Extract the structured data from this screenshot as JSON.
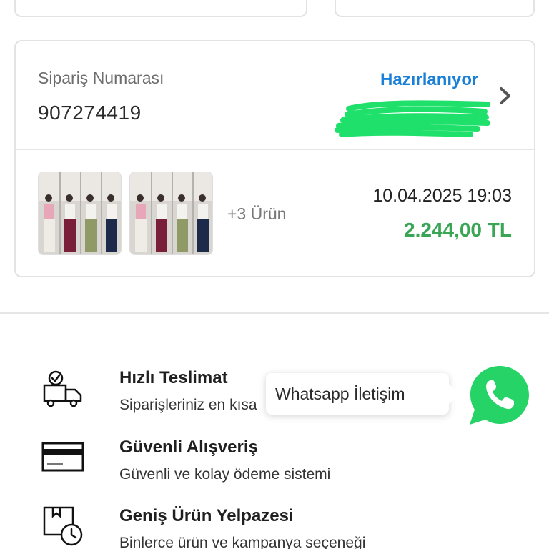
{
  "order": {
    "label": "Sipariş Numarası",
    "number": "907274419",
    "status": "Hazırlanıyor",
    "more_items": "+3 Ürün",
    "date": "10.04.2025 19:03",
    "price": "2.244,00 TL"
  },
  "features": [
    {
      "title": "Hızlı Teslimat",
      "desc": "Siparişleriniz en kısa",
      "icon": "delivery-truck-icon"
    },
    {
      "title": "Güvenli Alışveriş",
      "desc": "Güvenli ve kolay ödeme sistemi",
      "icon": "credit-card-icon"
    },
    {
      "title": "Geniş Ürün Yelpazesi",
      "desc": "Binlerce ürün ve kampanya seçeneği",
      "icon": "product-box-icon"
    }
  ],
  "whatsapp": {
    "label": "Whatsapp İletişim",
    "icon": "whatsapp-phone-icon"
  },
  "colors": {
    "status": "#1a7fd6",
    "price": "#3aa655",
    "whatsapp": "#25d366",
    "redaction": "#1ee06a"
  }
}
